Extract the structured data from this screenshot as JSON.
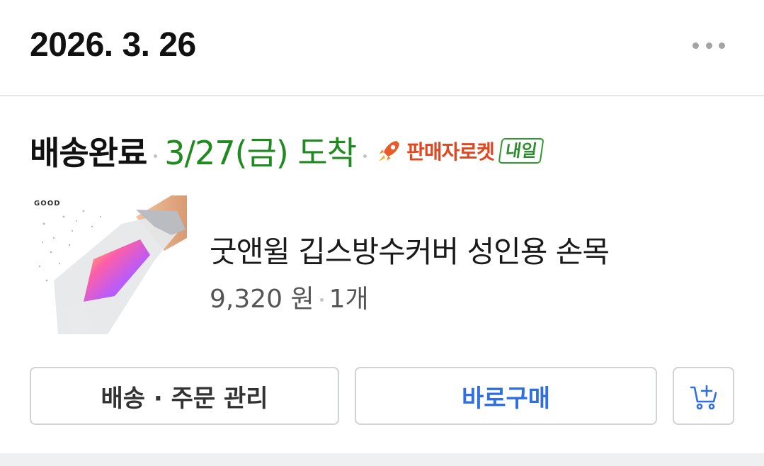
{
  "order": {
    "date": "2026. 3. 26"
  },
  "delivery": {
    "status": "배송완료",
    "arrival": "3/27(금) 도착",
    "badge_label": "판매자로켓",
    "badge_tag": "내일",
    "badge_icon": "rocket-icon",
    "arrival_color": "#1f8a1f",
    "badge_color": "#e2461e"
  },
  "product": {
    "name": "굿앤윌 깁스방수커버 성인용 손목",
    "price": "9,320 원",
    "quantity": "1개",
    "thumb_logo": "GOOD"
  },
  "actions": {
    "manage_label": "배송 · 주문 관리",
    "buy_label": "바로구매",
    "cart_icon": "add-to-cart-icon",
    "accent_color": "#2f6fe0"
  }
}
